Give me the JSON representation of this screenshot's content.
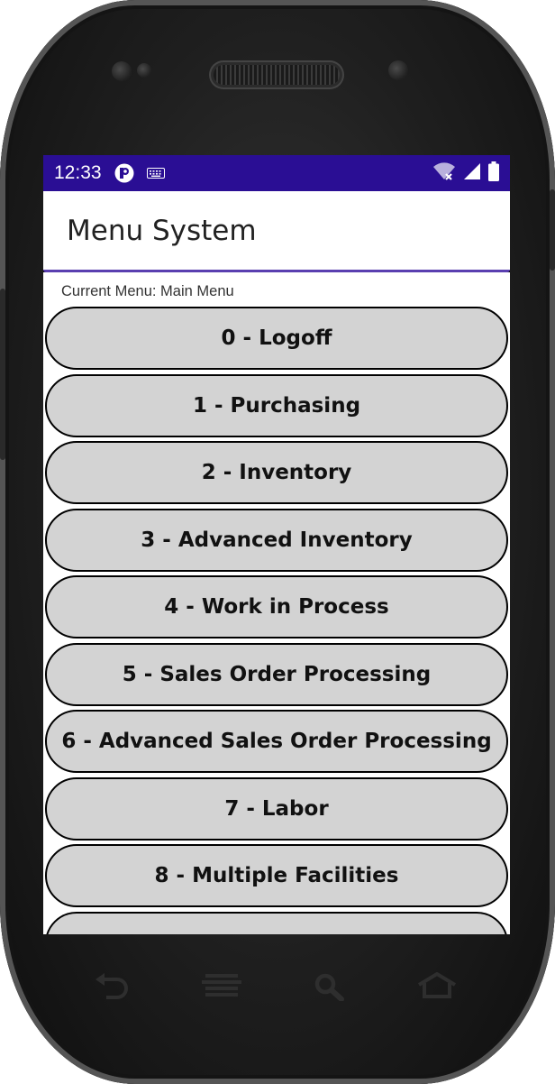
{
  "status_bar": {
    "time": "12:33",
    "icons": [
      "app-notification-icon",
      "keyboard-icon",
      "wifi-icon",
      "signal-icon",
      "battery-icon"
    ],
    "background": "#2a0e94"
  },
  "app_bar": {
    "title": "Menu System"
  },
  "current_menu": "Current Menu: Main Menu",
  "menu_items": [
    {
      "label": "0 - Logoff"
    },
    {
      "label": "1 - Purchasing"
    },
    {
      "label": "2 - Inventory"
    },
    {
      "label": "3 - Advanced Inventory"
    },
    {
      "label": "4 - Work in Process"
    },
    {
      "label": "5 - Sales Order Processing"
    },
    {
      "label": "6 - Advanced Sales Order Processing"
    },
    {
      "label": "7 - Labor"
    },
    {
      "label": "8 - Multiple Facilities"
    },
    {
      "label": ""
    }
  ],
  "nav_buttons": [
    "back-icon",
    "menu-icon",
    "search-icon",
    "home-icon"
  ],
  "colors": {
    "accent": "#5a3fb0",
    "button_bg": "#d3d3d3"
  }
}
